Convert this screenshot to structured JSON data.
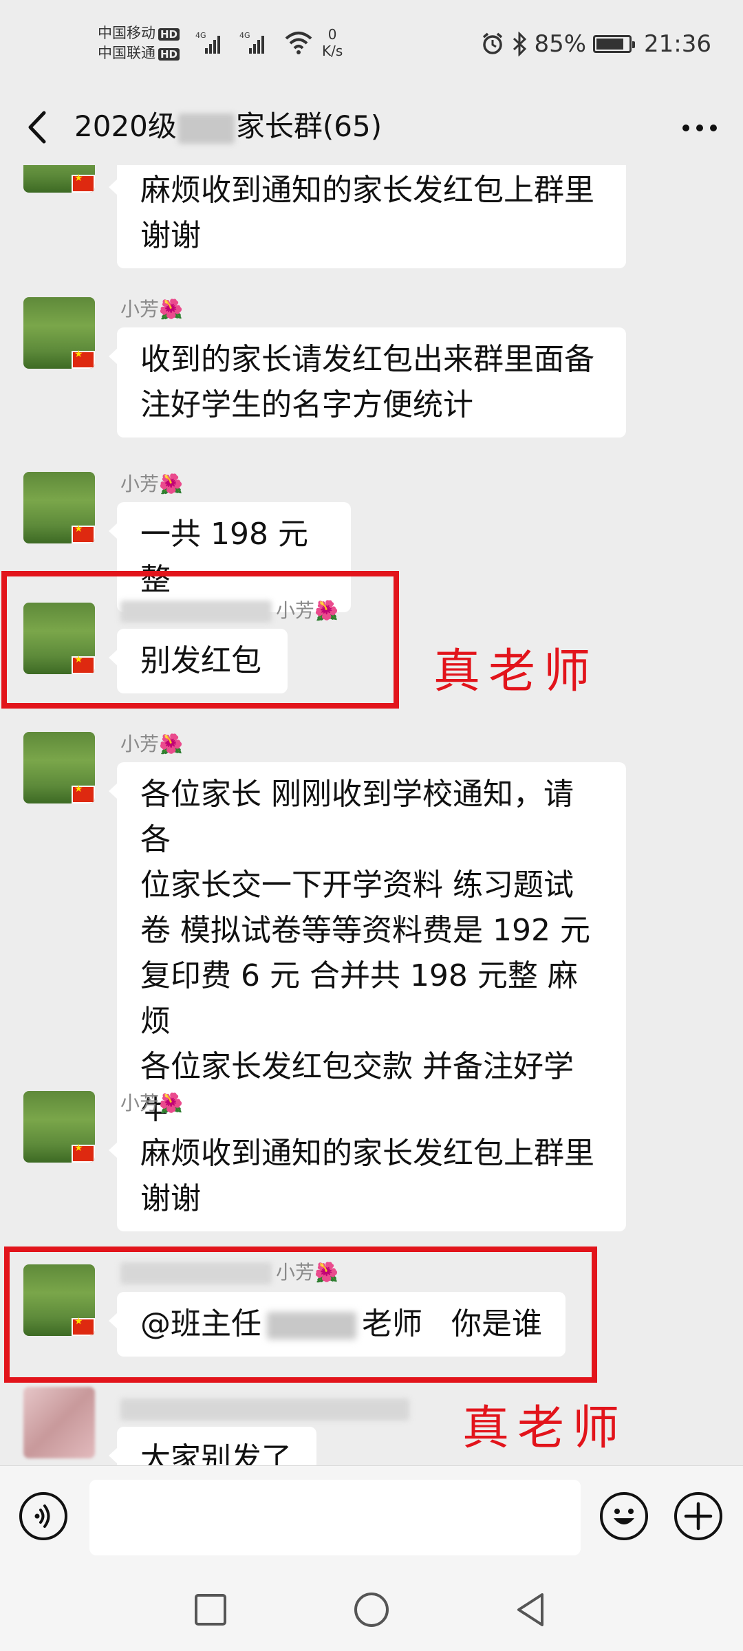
{
  "status": {
    "carrier1": "中国移动",
    "carrier2": "中国联通",
    "hd": "HD",
    "network": "4G",
    "speed_value": "0",
    "speed_unit": "K/s",
    "battery": "85%",
    "battery_level": 0.85,
    "time": "21:36"
  },
  "header": {
    "title_prefix": "2020级",
    "title_suffix": "家长群(65)"
  },
  "messages": [
    {
      "sender": "",
      "text": "麻烦收到通知的家长发红包上群里\n谢谢"
    },
    {
      "sender": "小芳",
      "text": "收到的家长请发红包出来群里面备\n注好学生的名字方便统计"
    },
    {
      "sender": "小芳",
      "text": "一共 198 元整"
    },
    {
      "sender": "小芳",
      "text": "别发红包"
    },
    {
      "sender": "小芳",
      "text": "各位家长 刚刚收到学校通知，请各\n位家长交一下开学资料 练习题试\n卷 模拟试卷等等资料费是 192 元\n复印费 6 元 合并共 198 元整 麻烦\n各位家长发红包交款 并备注好学生\n名字方便核对登记 谢谢。"
    },
    {
      "sender": "小芳",
      "text": "麻烦收到通知的家长发红包上群里\n谢谢"
    },
    {
      "sender": "小芳",
      "text_prefix": "@班主任",
      "text_mid": "老师",
      "text_suffix": "你是谁"
    },
    {
      "sender": "",
      "text": "大家别发了"
    }
  ],
  "sender_emoji": "🌺",
  "annotations": {
    "label": "真老师"
  },
  "icons": {
    "back": "back-arrow-icon",
    "more": "more-dots-icon",
    "voice": "voice-icon",
    "emoji": "emoji-icon",
    "plus": "plus-icon",
    "alarm": "alarm-icon",
    "bluetooth": "bluetooth-icon",
    "wifi": "wifi-icon"
  },
  "colors": {
    "annotation_red": "#e2141b",
    "background": "#ededed",
    "bubble": "#ffffff"
  }
}
